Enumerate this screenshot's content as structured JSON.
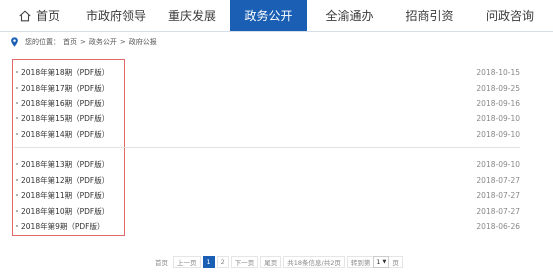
{
  "nav": {
    "items": [
      {
        "label": "首页",
        "icon": "home-icon",
        "active": false
      },
      {
        "label": "市政府领导",
        "active": false
      },
      {
        "label": "重庆发展",
        "active": false
      },
      {
        "label": "政务公开",
        "active": true
      },
      {
        "label": "全渝通办",
        "active": false
      },
      {
        "label": "招商引资",
        "active": false
      },
      {
        "label": "问政咨询",
        "active": false
      }
    ]
  },
  "breadcrumb": {
    "icon": "location-pin-icon",
    "prefix": "您的位置：",
    "items": [
      "首页",
      ">",
      "政务公开",
      ">",
      "政府公报"
    ]
  },
  "list": {
    "group1": [
      {
        "title": "2018年第18期（PDF版）",
        "date": "2018-10-15"
      },
      {
        "title": "2018年第17期（PDF版）",
        "date": "2018-09-25"
      },
      {
        "title": "2018年第16期（PDF版）",
        "date": "2018-09-16"
      },
      {
        "title": "2018年第15期（PDF版）",
        "date": "2018-09-10"
      },
      {
        "title": "2018年第14期（PDF版）",
        "date": "2018-09-10"
      }
    ],
    "group2": [
      {
        "title": "2018年第13期（PDF版）",
        "date": "2018-09-10"
      },
      {
        "title": "2018年第12期（PDF版）",
        "date": "2018-07-27"
      },
      {
        "title": "2018年第11期（PDF版）",
        "date": "2018-07-27"
      },
      {
        "title": "2018年第10期（PDF版）",
        "date": "2018-07-27"
      },
      {
        "title": "2018年第9期（PDF版）",
        "date": "2018-06-26"
      }
    ]
  },
  "pager": {
    "first": "首页",
    "prev": "上一页",
    "pages": [
      "1",
      "2"
    ],
    "current": "1",
    "next": "下一页",
    "last": "尾页",
    "summary": "共18条信息/共2页",
    "goto_label": "转到第",
    "goto_value": "1",
    "goto_suffix": "页"
  },
  "colors": {
    "accent": "#1a5fb4",
    "highlight_box": "#e06a6a"
  }
}
